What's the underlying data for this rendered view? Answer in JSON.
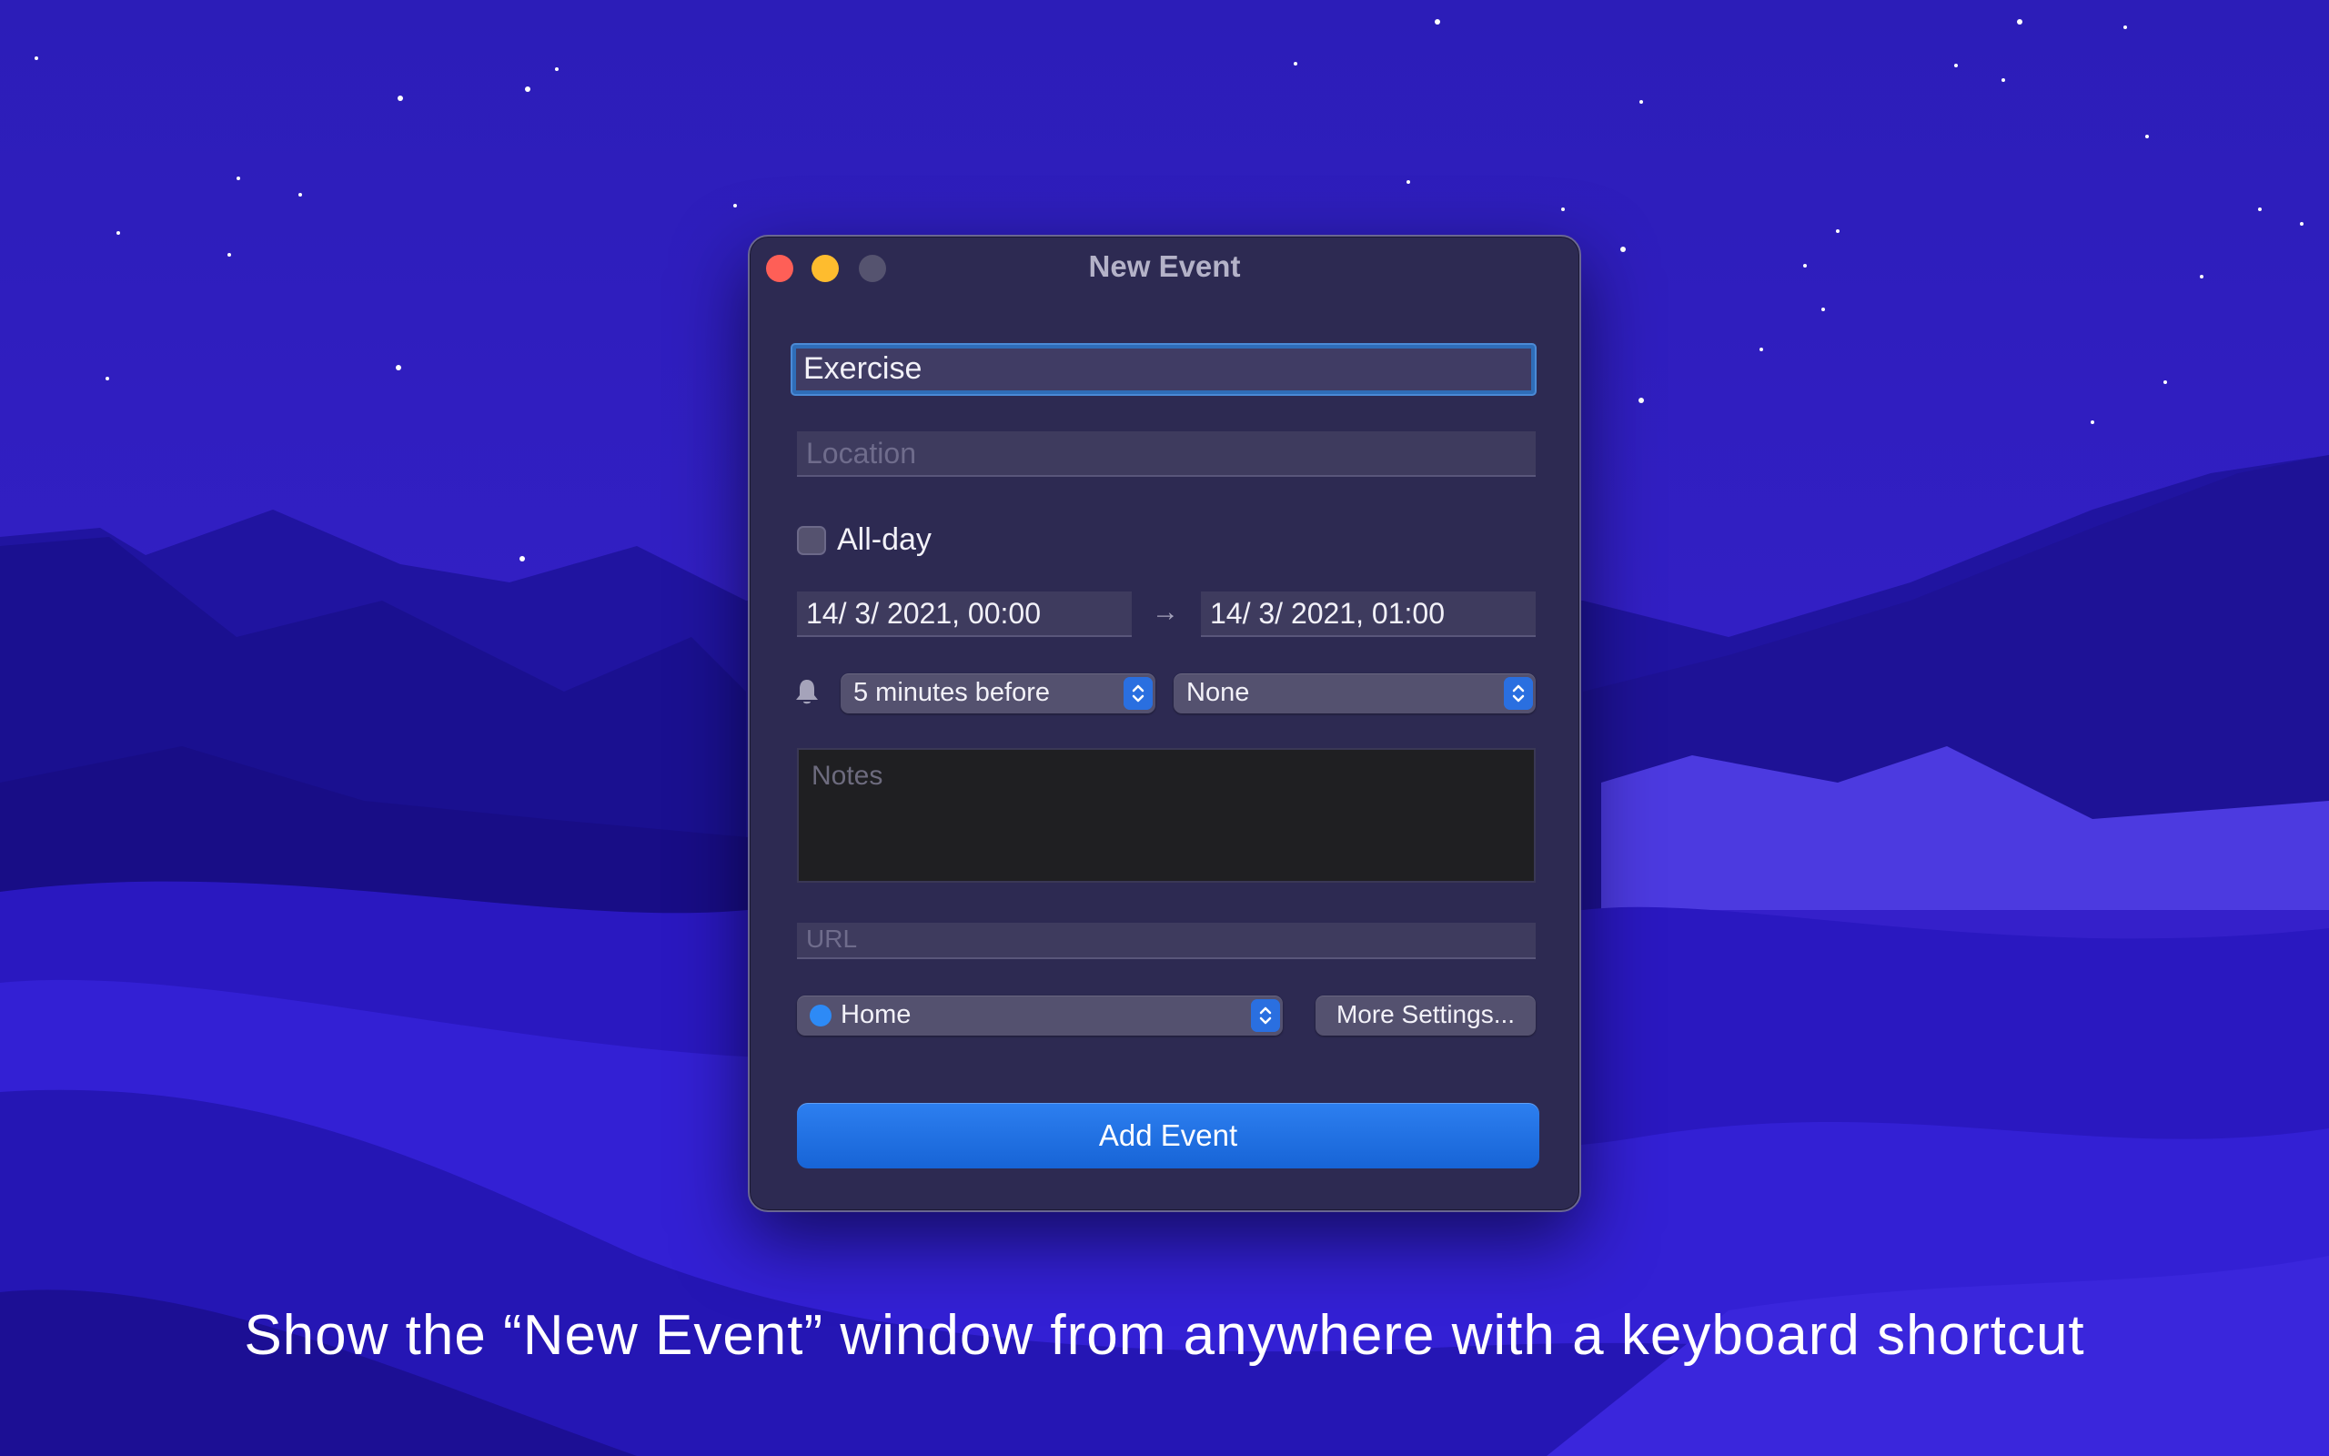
{
  "window": {
    "title": "New Event",
    "title_field": {
      "value": "Exercise"
    },
    "location_field": {
      "placeholder": "Location"
    },
    "all_day": {
      "label": "All-day",
      "checked": false
    },
    "start_date": "14/  3/ 2021, 00:00",
    "date_arrow": "→",
    "end_date": "14/  3/ 2021,  01:00",
    "alert": {
      "selected": "5 minutes before"
    },
    "second_alert": {
      "selected": "None"
    },
    "notes_field": {
      "placeholder": "Notes"
    },
    "url_field": {
      "placeholder": "URL"
    },
    "calendar": {
      "selected": "Home",
      "color": "#2d8af6"
    },
    "more_settings_label": "More Settings...",
    "add_event_label": "Add Event"
  },
  "caption": "Show the “New Event” window from anywhere with a keyboard shortcut",
  "colors": {
    "accent": "#1f6fe4",
    "window_background": "#2d2a52",
    "close": "#fe5f57",
    "minimize": "#febc2e"
  }
}
